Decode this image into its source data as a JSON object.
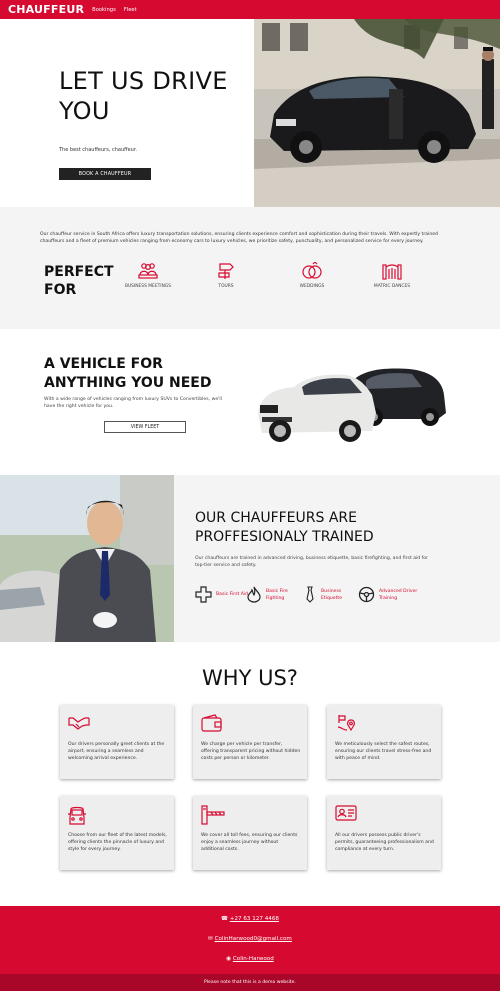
{
  "nav": {
    "brand": "CHAUFFEUR",
    "links": [
      "Bookings",
      "Fleet"
    ]
  },
  "hero": {
    "title": "LET US DRIVE YOU",
    "subtitle": "The best chauffeurs, chauffeur.",
    "cta": "BOOK A CHAUFFEUR"
  },
  "perfect": {
    "intro": "Our chauffeur service in South Africa offers luxury transportation solutions, ensuring clients experience comfort and sophistication during their travels. With expertly trained chauffeurs and a fleet of premium vehicles ranging from economy cars to luxury vehicles, we prioritize safety, punctuality, and personalized service for every journey.",
    "heading": "PERFECT FOR",
    "items": [
      {
        "label": "BUSINESS MEETINGS",
        "icon": "people-group-icon"
      },
      {
        "label": "TOURS",
        "icon": "signpost-icon"
      },
      {
        "label": "WEDDINGS",
        "icon": "rings-icon"
      },
      {
        "label": "MATRIC DANCES",
        "icon": "gate-icon"
      }
    ]
  },
  "vehicle": {
    "heading": "A VEHICLE FOR ANYTHING YOU NEED",
    "subtitle": "With a wide range of vehicles ranging from luxury SUVs to Convertibles, we'll have the right vehicle for you.",
    "cta": "VIEW FLEET"
  },
  "drivers": {
    "heading": "OUR CHAUFFEURS ARE PROFFESIONALY TRAINED",
    "subtitle": "Our chauffeurs are trained in advanced driving, business etiquette, basic firefighting, and first aid for top-tier service and safety.",
    "trainings": [
      {
        "label": "Basic First Aid",
        "icon": "first-aid-cross-icon"
      },
      {
        "label": "Basic Fire Fighting",
        "icon": "flame-icon"
      },
      {
        "label": "Business Etiquette",
        "icon": "tie-icon"
      },
      {
        "label": "Advanced Driver Training",
        "icon": "steering-wheel-icon"
      }
    ]
  },
  "why": {
    "heading": "WHY US?",
    "cards": [
      {
        "text": "Our drivers personally greet clients at the airport, ensuring a seamless and welcoming arrival experience.",
        "icon": "handshake-icon"
      },
      {
        "text": "We charge per vehicle per transfer, offering transparent pricing without hidden costs per person or kilometer.",
        "icon": "wallet-icon"
      },
      {
        "text": "We meticulously select the safest routes, ensuring our clients travel stress-free and with peace of mind.",
        "icon": "route-icon"
      },
      {
        "text": "Choose from our fleet of the latest models, offering clients the pinnacle of luxury and style for every journey.",
        "icon": "car-front-icon"
      },
      {
        "text": "We cover all toll fees, ensuring our clients enjoy a seamless journey without additional costs.",
        "icon": "toll-gate-icon"
      },
      {
        "text": "All our drivers possess public driver's permits, guaranteeing professionalism and compliance at every turn.",
        "icon": "id-card-icon"
      }
    ]
  },
  "footer": {
    "phone": "+27 63 127 4468",
    "email": "ColinHarwood0@gmail.com",
    "github": "Colin-Harwood",
    "note": "Please note that this is a demo website."
  },
  "colors": {
    "accent": "#d60a30",
    "dark": "#222222",
    "band": "#f4f4f4"
  }
}
